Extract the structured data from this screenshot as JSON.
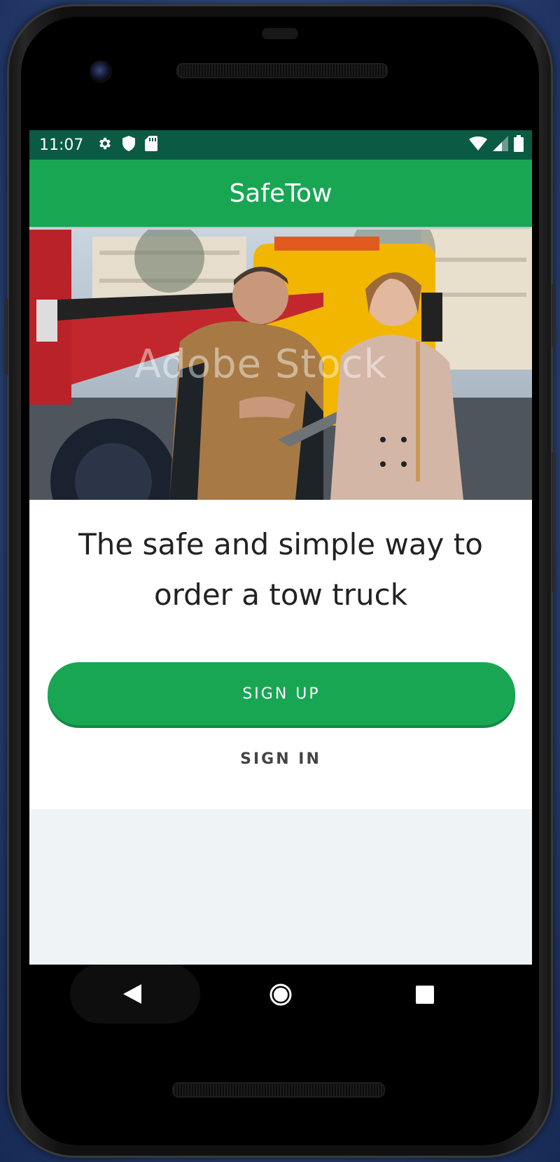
{
  "status_bar": {
    "time": "11:07",
    "left_icons": [
      "gear-icon",
      "shield-icon",
      "sd-card-icon"
    ],
    "right_icons": [
      "wifi-icon",
      "signal-icon",
      "battery-icon"
    ]
  },
  "app_bar": {
    "title": "SafeTow"
  },
  "hero": {
    "watermark": "Adobe Stock",
    "image_subject": "tow truck driver talking with a woman holding a tablet"
  },
  "content": {
    "tagline": "The safe and simple way to order a tow truck",
    "signup_label": "SIGN UP",
    "signin_label": "SIGN IN"
  },
  "nav_bar": {
    "icons": [
      "back-icon",
      "home-icon",
      "recents-icon"
    ]
  },
  "colors": {
    "primary": "#19a653",
    "status_bar": "#0a5a44",
    "background": "#f0f3f6",
    "text": "#222222"
  }
}
